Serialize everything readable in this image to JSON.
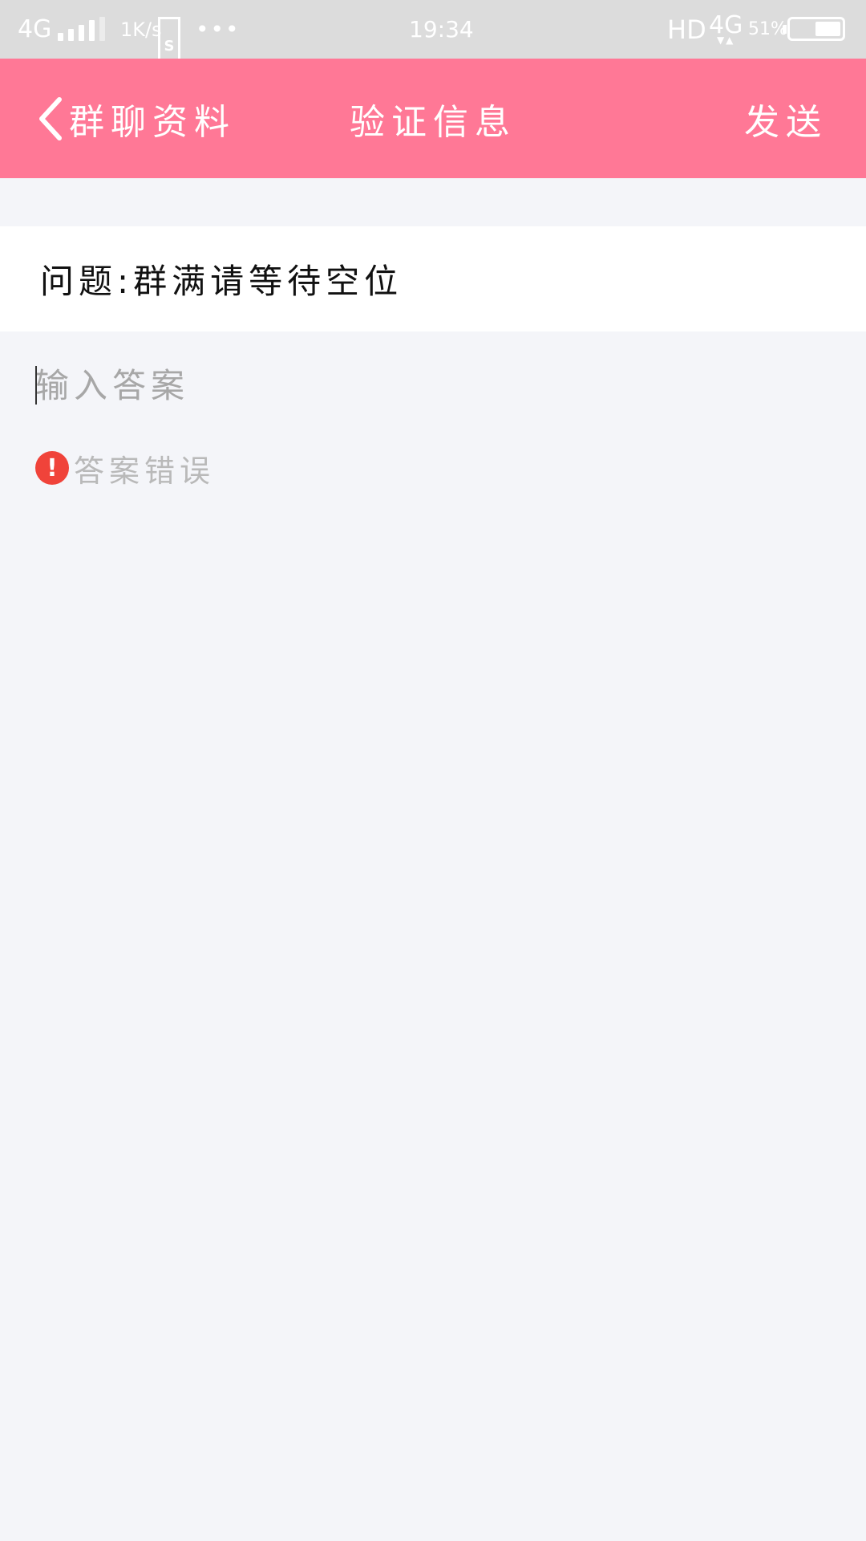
{
  "status_bar": {
    "network": "4G",
    "speed": "1K/s",
    "s_icon": "S",
    "dots": "•••",
    "time": "19:34",
    "hd": "HD",
    "network2": "4G",
    "network2_arrows": "▼▲",
    "battery_percent": "51%",
    "battery_level": 0.51,
    "icons": [
      "signal-icon",
      "s-app-icon",
      "more-dots-icon",
      "battery-icon"
    ]
  },
  "header": {
    "back_label": "群聊资料",
    "title": "验证信息",
    "send_label": "发送",
    "color": "#ff7896"
  },
  "question": {
    "text": "问题:群满请等待空位"
  },
  "answer": {
    "value": "",
    "placeholder": "输入答案"
  },
  "error": {
    "icon": "!",
    "text": "答案错误",
    "color": "#f0433a"
  }
}
